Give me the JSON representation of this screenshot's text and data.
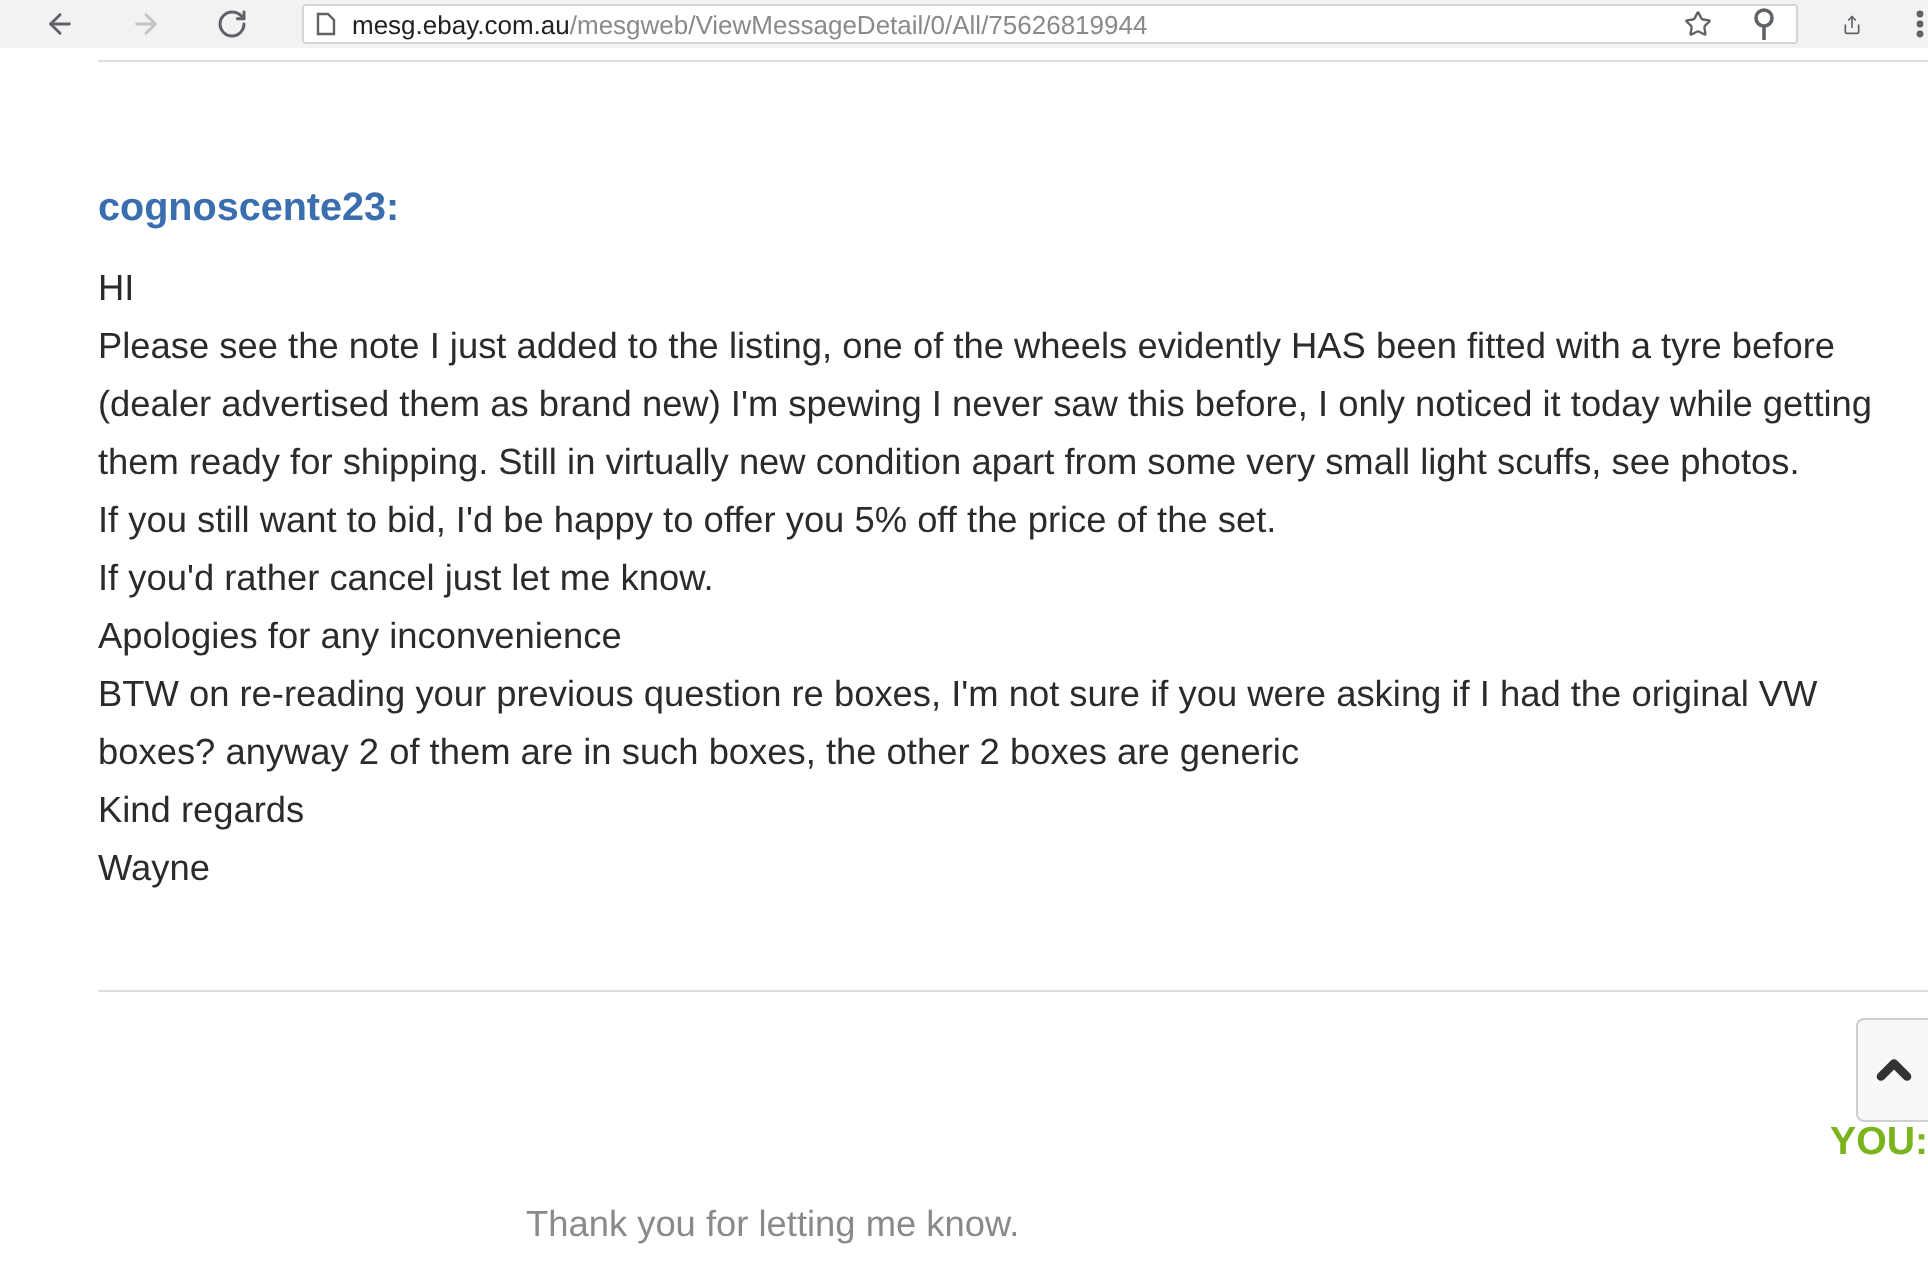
{
  "browser": {
    "nav_buttons": [
      {
        "kind": "back",
        "disabled": false
      },
      {
        "kind": "forward",
        "disabled": true
      },
      {
        "kind": "reload",
        "disabled": false
      }
    ],
    "address_bar": {
      "host": "mesg.ebay.com.au",
      "path": "/mesgweb/ViewMessageDetail/0/All/75626819944"
    }
  },
  "message": {
    "sender": "cognoscente23:",
    "lines": [
      "HI",
      "Please see the note I just added to the listing, one of the wheels evidently HAS been fitted with a tyre before (dealer advertised them as brand new) I'm spewing I never saw this before, I only noticed it today while getting them ready for shipping. Still in virtually new condition apart from some very small light scuffs, see photos.",
      "If you still want to bid, I'd be happy to offer you 5% off the price of the set.",
      "If you'd rather cancel just let me know.",
      "Apologies for any inconvenience",
      "BTW on re-reading your previous question re boxes, I'm not sure if you were asking if I had the original VW boxes? anyway 2 of them are in such boxes, the other 2 boxes are generic",
      "Kind regards",
      "Wayne"
    ]
  },
  "reply": {
    "label": "YOU:",
    "text": "Thank you for letting me know."
  }
}
